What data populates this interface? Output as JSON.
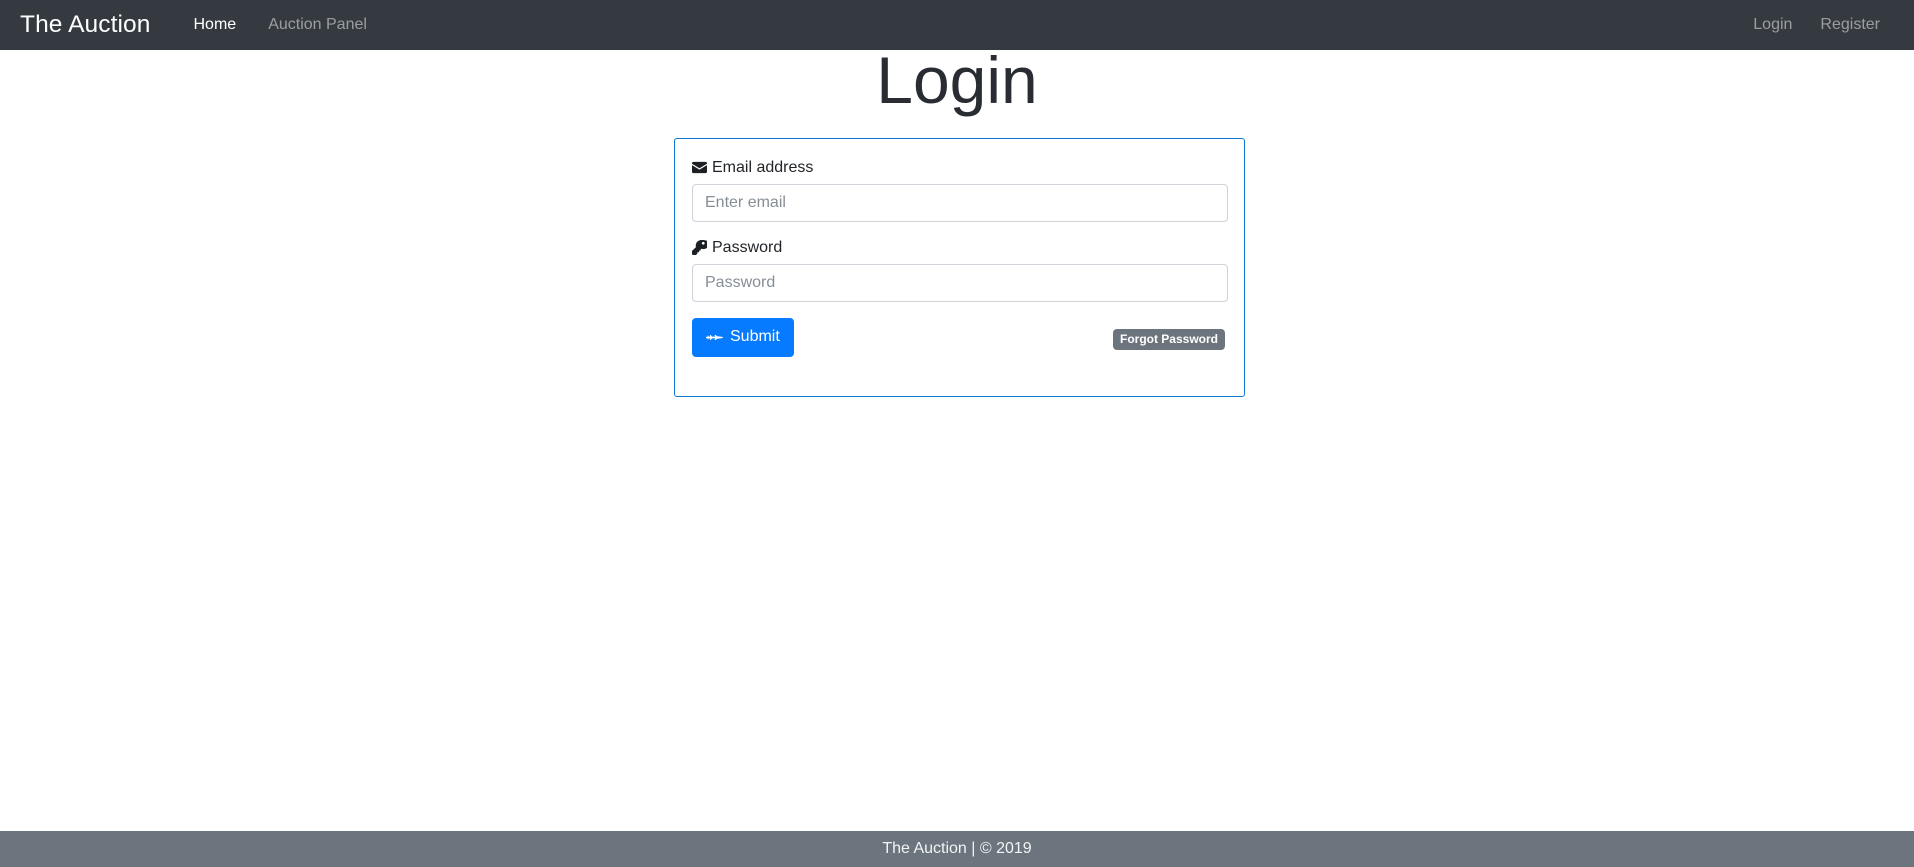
{
  "navbar": {
    "brand": "The Auction",
    "links": [
      {
        "label": "Home",
        "state": "active"
      },
      {
        "label": "Auction Panel",
        "state": "muted"
      }
    ],
    "right_links": [
      {
        "label": "Login"
      },
      {
        "label": "Register"
      }
    ],
    "background_color": "#343a40"
  },
  "page": {
    "title": "Login"
  },
  "form": {
    "border_color": "#1179d4",
    "email": {
      "icon": "envelope-icon",
      "label": "Email address",
      "placeholder": "Enter email",
      "value": ""
    },
    "password": {
      "icon": "key-icon",
      "label": "Password",
      "placeholder": "Password",
      "value": ""
    },
    "submit": {
      "icon": "fighter-jet-icon",
      "label": "Submit",
      "color": "#067bff"
    },
    "forgot": {
      "label": "Forgot Password",
      "color": "#6c757d"
    }
  },
  "footer": {
    "text": "The Auction | © 2019",
    "background_color": "#6c757d"
  }
}
